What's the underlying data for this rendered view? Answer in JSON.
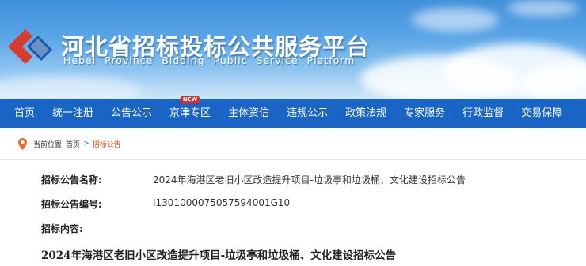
{
  "header": {
    "title_cn": "河北省招标投标公共服务平台",
    "title_en": "Hebei Province Bidding Public Service Platform",
    "colors": {
      "brand_blue": "#1a64c6",
      "logo_red": "#d83a2c",
      "logo_blue": "#1c57a8"
    }
  },
  "nav": {
    "items": [
      {
        "label": "首页"
      },
      {
        "label": "统一注册"
      },
      {
        "label": "公告公示"
      },
      {
        "label": "京津专区",
        "badge": "NEW"
      },
      {
        "label": "主体资信"
      },
      {
        "label": "违规公示"
      },
      {
        "label": "政策法规"
      },
      {
        "label": "专家服务"
      },
      {
        "label": "行政监督"
      },
      {
        "label": "交易保障"
      }
    ]
  },
  "breadcrumb": {
    "icon": "location-pin-icon",
    "prefix": "当前位置:",
    "home": "首页",
    "separator": ">",
    "current": "招标公告"
  },
  "notice": {
    "name_label": "招标公告名称:",
    "name_value": "2024年海港区老旧小区改造提升项目-垃圾亭和垃圾桶、文化建设招标公告",
    "code_label": "招标公告编号:",
    "code_value": "I13010000750575940​01G10",
    "content_label": "招标内容:",
    "doc_title": "2024年海港区老旧小区改造提升项目-垃圾亭和垃圾桶、文化建设招标公告"
  }
}
